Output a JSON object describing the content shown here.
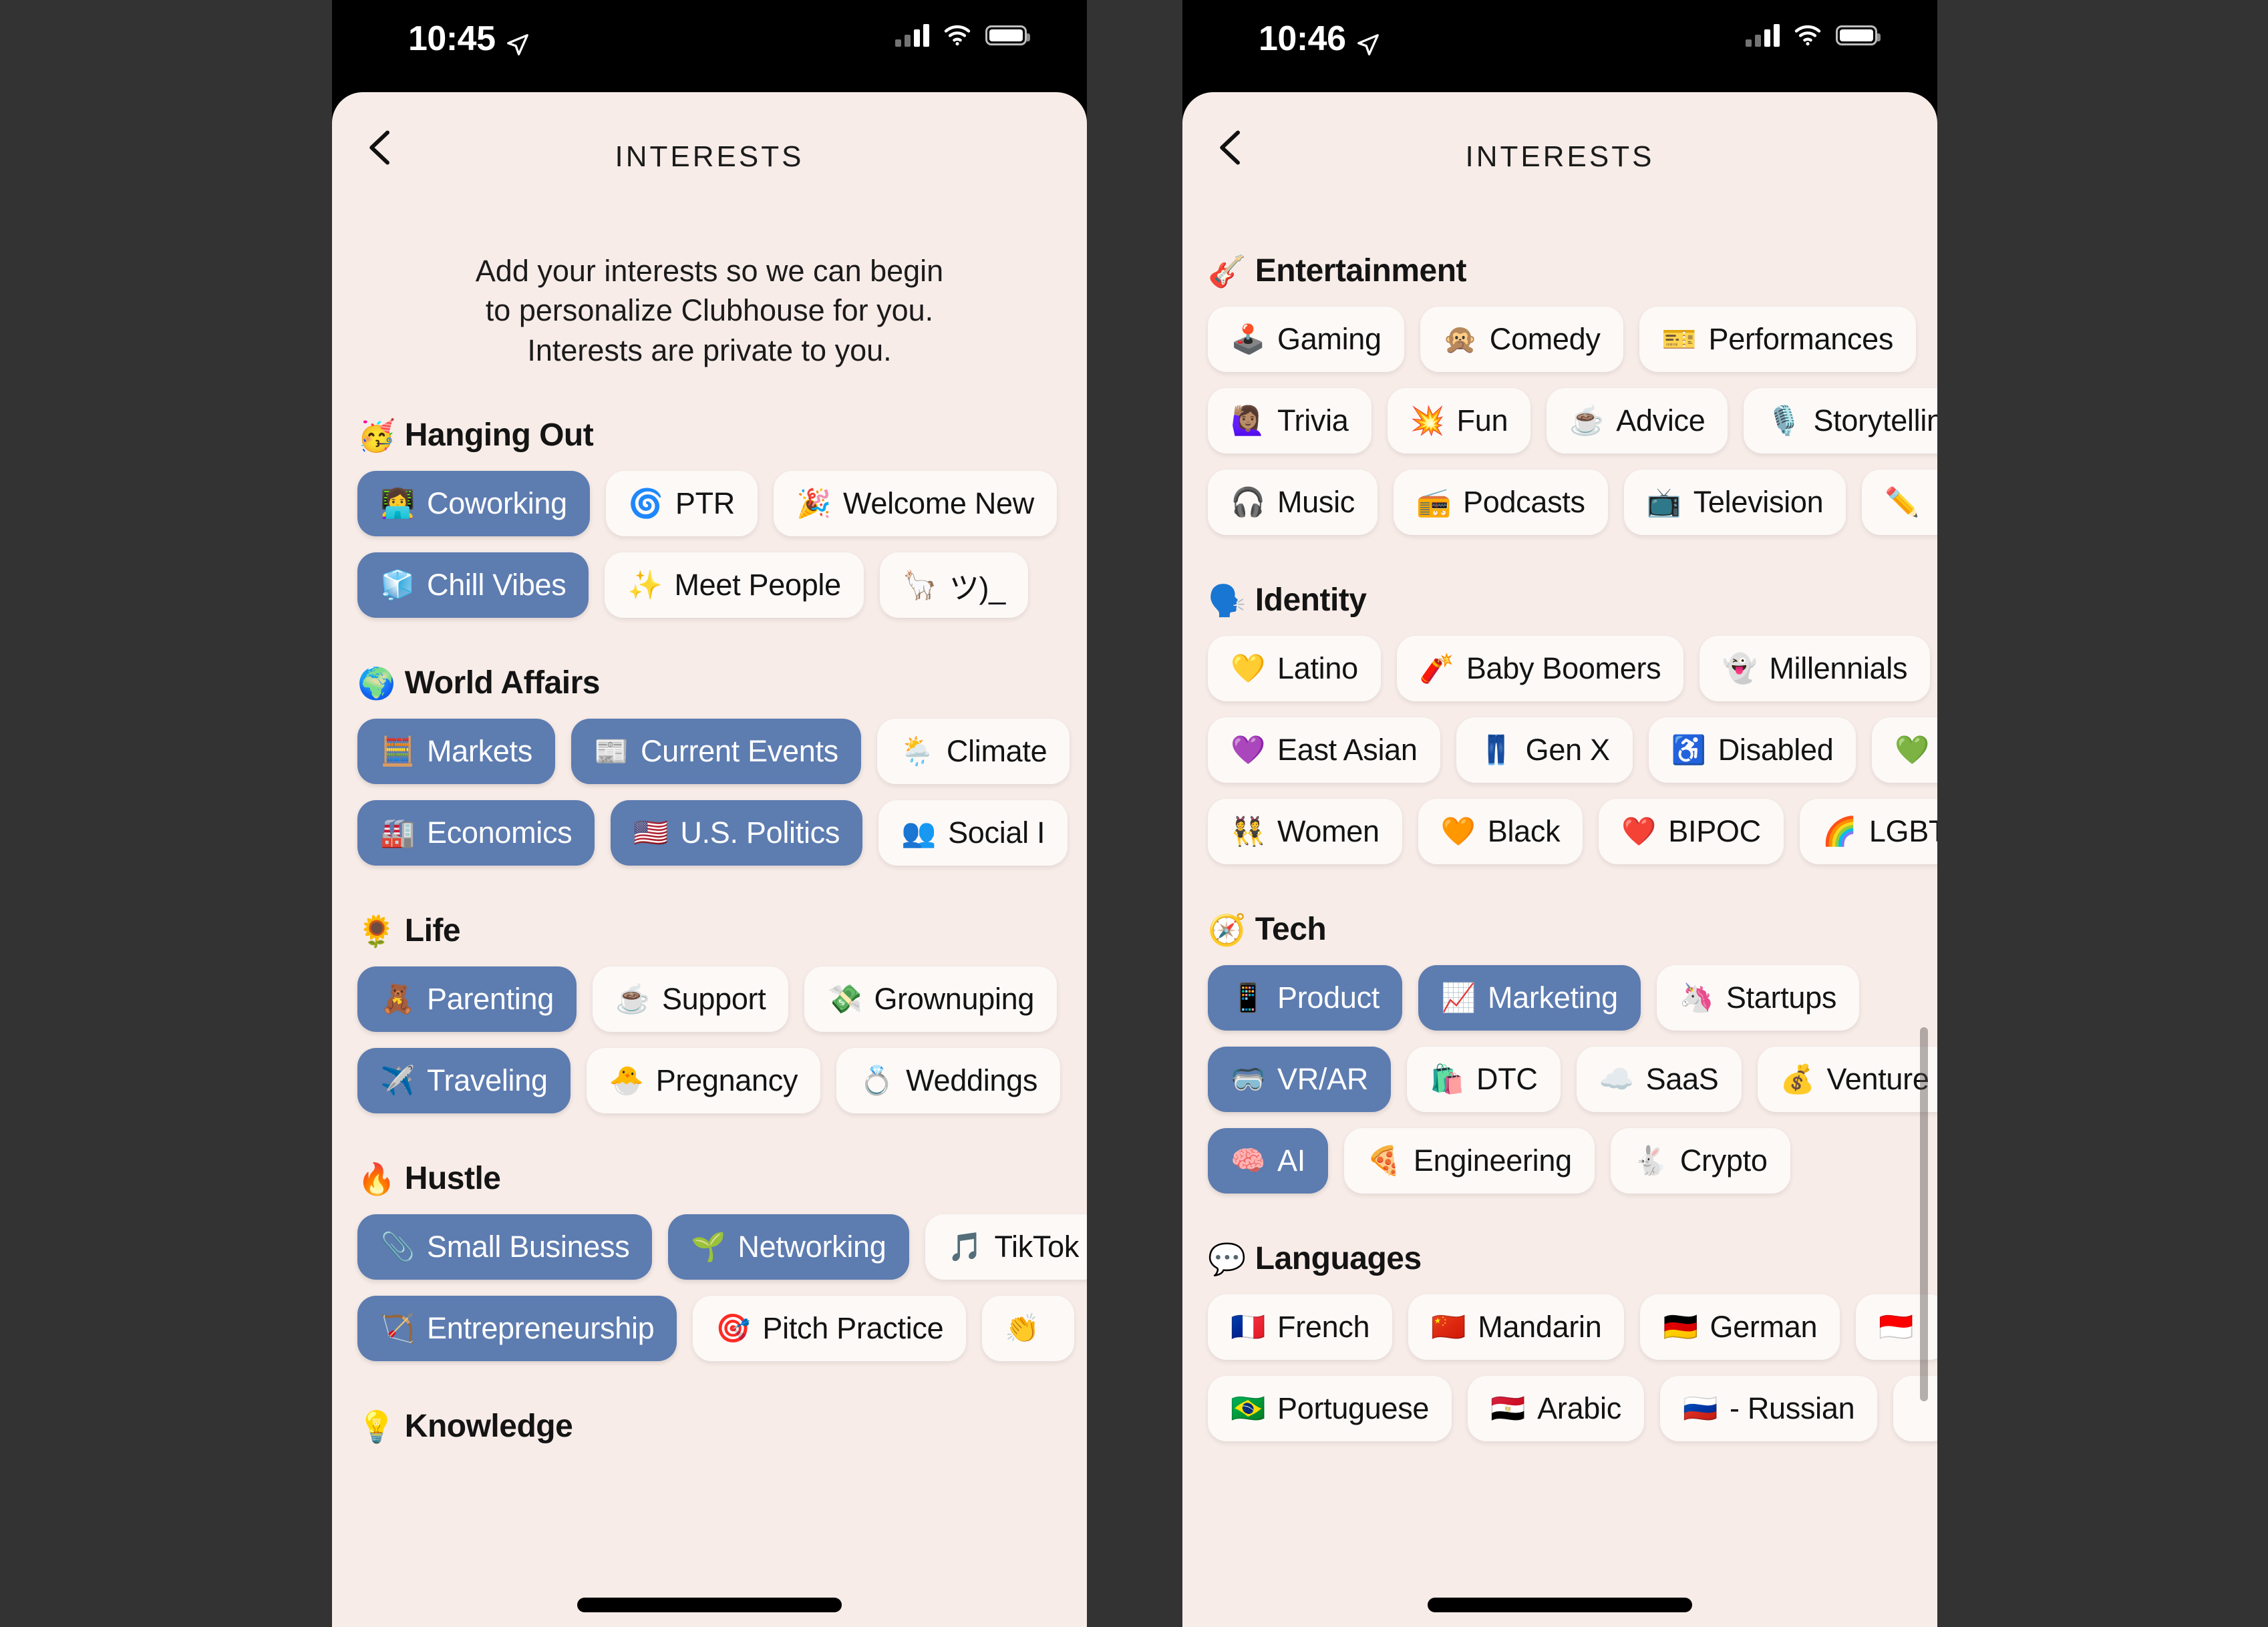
{
  "colors": {
    "page_background": "#333333",
    "card_background": "#f7ece8",
    "pill_selected": "#5d7cb0",
    "pill_unselected": "#fcf9f7",
    "text": "#131313",
    "status_bar": "#000000"
  },
  "phones": [
    {
      "id": "left",
      "status": {
        "time": "10:45",
        "location_icon": "location-arrow-icon",
        "signal_icon": "cellular-signal-icon",
        "wifi_icon": "wifi-icon",
        "battery_icon": "battery-full-icon"
      },
      "nav": {
        "back_icon": "chevron-left-icon",
        "title": "INTERESTS"
      },
      "intro": "Add your interests so we can begin\nto personalize Clubhouse for you.\nInterests are private to you.",
      "intro_lines": [
        "Add your interests so we can begin",
        "to personalize Clubhouse for you.",
        "Interests are private to you."
      ],
      "sections": [
        {
          "emoji": "🥳",
          "title": "Hanging Out",
          "rows": [
            [
              {
                "emoji": "👩‍💻",
                "label": "Coworking",
                "selected": true
              },
              {
                "emoji": "🌀",
                "label": "PTR",
                "selected": false
              },
              {
                "emoji": "🎉",
                "label": "Welcome New",
                "selected": false,
                "clipped": true
              }
            ],
            [
              {
                "emoji": "🧊",
                "label": "Chill Vibes",
                "selected": true
              },
              {
                "emoji": "✨",
                "label": "Meet People",
                "selected": false
              },
              {
                "emoji": "🦙",
                "label": "ツ)_",
                "selected": false,
                "clipped": true
              }
            ]
          ]
        },
        {
          "emoji": "🌍",
          "title": "World Affairs",
          "rows": [
            [
              {
                "emoji": "🧮",
                "label": "Markets",
                "selected": true
              },
              {
                "emoji": "📰",
                "label": "Current Events",
                "selected": true
              },
              {
                "emoji": "🌦️",
                "label": "Climate",
                "selected": false,
                "clipped": true
              }
            ],
            [
              {
                "emoji": "🏭",
                "label": "Economics",
                "selected": true
              },
              {
                "emoji": "🇺🇸",
                "label": "U.S. Politics",
                "selected": true
              },
              {
                "emoji": "👥",
                "label": "Social I",
                "selected": false,
                "clipped": true
              }
            ]
          ]
        },
        {
          "emoji": "🌻",
          "title": "Life",
          "rows": [
            [
              {
                "emoji": "🧸",
                "label": "Parenting",
                "selected": true
              },
              {
                "emoji": "☕",
                "label": "Support",
                "selected": false
              },
              {
                "emoji": "💸",
                "label": "Grownuping",
                "selected": false,
                "clipped": true
              }
            ],
            [
              {
                "emoji": "✈️",
                "label": "Traveling",
                "selected": true
              },
              {
                "emoji": "🐣",
                "label": "Pregnancy",
                "selected": false
              },
              {
                "emoji": "💍",
                "label": "Weddings",
                "selected": false,
                "clipped": true
              }
            ]
          ]
        },
        {
          "emoji": "🔥",
          "title": "Hustle",
          "rows": [
            [
              {
                "emoji": "📎",
                "label": "Small Business",
                "selected": true
              },
              {
                "emoji": "🌱",
                "label": "Networking",
                "selected": true
              },
              {
                "emoji": "🎵",
                "label": "TikTok",
                "selected": false,
                "clipped": true
              }
            ],
            [
              {
                "emoji": "🏹",
                "label": "Entrepreneurship",
                "selected": true
              },
              {
                "emoji": "🎯",
                "label": "Pitch Practice",
                "selected": false
              },
              {
                "emoji": "👏",
                "label": "",
                "selected": false,
                "clipped": true
              }
            ]
          ]
        },
        {
          "emoji": "💡",
          "title": "Knowledge",
          "rows": []
        }
      ]
    },
    {
      "id": "right",
      "status": {
        "time": "10:46",
        "location_icon": "location-arrow-icon",
        "signal_icon": "cellular-signal-icon",
        "wifi_icon": "wifi-icon",
        "battery_icon": "battery-full-icon"
      },
      "nav": {
        "back_icon": "chevron-left-icon",
        "title": "INTERESTS"
      },
      "sections": [
        {
          "emoji": "🎸",
          "title": "Entertainment",
          "rows": [
            [
              {
                "emoji": "🕹️",
                "label": "Gaming",
                "selected": false
              },
              {
                "emoji": "🙊",
                "label": "Comedy",
                "selected": false
              },
              {
                "emoji": "🎫",
                "label": "Performances",
                "selected": false,
                "clipped": true
              }
            ],
            [
              {
                "emoji": "🙋🏽‍♀️",
                "label": "Trivia",
                "selected": false
              },
              {
                "emoji": "💥",
                "label": "Fun",
                "selected": false
              },
              {
                "emoji": "☕",
                "label": "Advice",
                "selected": false
              },
              {
                "emoji": "🎙️",
                "label": "Storytelling",
                "selected": false,
                "clipped": true
              }
            ],
            [
              {
                "emoji": "🎧",
                "label": "Music",
                "selected": false
              },
              {
                "emoji": "📻",
                "label": "Podcasts",
                "selected": false
              },
              {
                "emoji": "📺",
                "label": "Television",
                "selected": false
              },
              {
                "emoji": "✏️",
                "label": "",
                "selected": false,
                "clipped": true
              }
            ]
          ]
        },
        {
          "emoji": "🗣️",
          "title": "Identity",
          "rows": [
            [
              {
                "emoji": "💛",
                "label": "Latino",
                "selected": false
              },
              {
                "emoji": "🧨",
                "label": "Baby Boomers",
                "selected": false
              },
              {
                "emoji": "👻",
                "label": "Millennials",
                "selected": false,
                "clipped": true
              }
            ],
            [
              {
                "emoji": "💜",
                "label": "East Asian",
                "selected": false
              },
              {
                "emoji": "👖",
                "label": "Gen X",
                "selected": false
              },
              {
                "emoji": "♿",
                "label": "Disabled",
                "selected": false
              },
              {
                "emoji": "💚",
                "label": "",
                "selected": false,
                "clipped": true
              }
            ],
            [
              {
                "emoji": "👯",
                "label": "Women",
                "selected": false
              },
              {
                "emoji": "🧡",
                "label": "Black",
                "selected": false
              },
              {
                "emoji": "❤️",
                "label": "BIPOC",
                "selected": false
              },
              {
                "emoji": "🌈",
                "label": "LGBTQ+",
                "selected": false,
                "clipped": true
              }
            ]
          ]
        },
        {
          "emoji": "🧭",
          "title": "Tech",
          "rows": [
            [
              {
                "emoji": "📱",
                "label": "Product",
                "selected": true
              },
              {
                "emoji": "📈",
                "label": "Marketing",
                "selected": true
              },
              {
                "emoji": "🦄",
                "label": "Startups",
                "selected": false
              }
            ],
            [
              {
                "emoji": "🥽",
                "label": "VR/AR",
                "selected": true
              },
              {
                "emoji": "🛍️",
                "label": "DTC",
                "selected": false
              },
              {
                "emoji": "☁️",
                "label": "SaaS",
                "selected": false
              },
              {
                "emoji": "💰",
                "label": "Venture",
                "selected": false,
                "clipped": true
              }
            ],
            [
              {
                "emoji": "🧠",
                "label": "AI",
                "selected": true
              },
              {
                "emoji": "🍕",
                "label": "Engineering",
                "selected": false
              },
              {
                "emoji": "🐇",
                "label": "Crypto",
                "selected": false
              }
            ]
          ]
        },
        {
          "emoji": "💬",
          "title": "Languages",
          "rows": [
            [
              {
                "emoji": "🇫🇷",
                "label": "French",
                "selected": false
              },
              {
                "emoji": "🇨🇳",
                "label": "Mandarin",
                "selected": false
              },
              {
                "emoji": "🇩🇪",
                "label": "German",
                "selected": false
              },
              {
                "emoji": "🇮🇩",
                "label": "",
                "selected": false,
                "clipped": true
              }
            ],
            [
              {
                "emoji": "🇧🇷",
                "label": "Portuguese",
                "selected": false
              },
              {
                "emoji": "🇪🇬",
                "label": "Arabic",
                "selected": false
              },
              {
                "emoji": "🇷🇺",
                "label": "- Russian",
                "selected": false
              },
              {
                "emoji": "",
                "label": "",
                "selected": false,
                "clipped": true
              }
            ]
          ]
        }
      ],
      "scroll_indicator": "vertical-scrollbar"
    }
  ]
}
